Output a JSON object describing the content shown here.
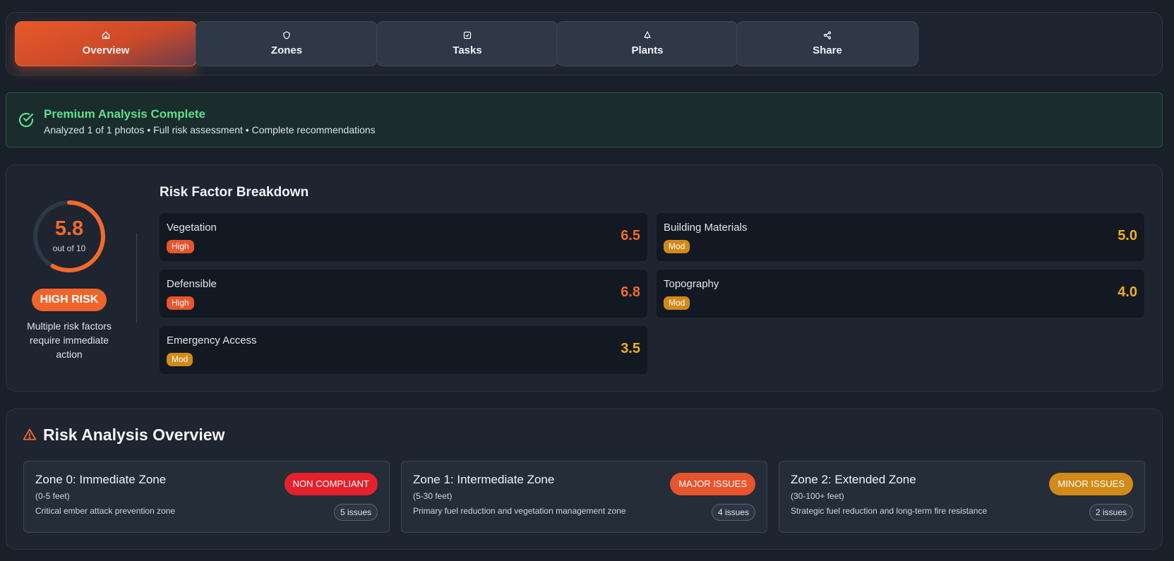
{
  "tabs": [
    {
      "label": "Overview",
      "icon": "home-icon",
      "active": true
    },
    {
      "label": "Zones",
      "icon": "shield-icon",
      "active": false
    },
    {
      "label": "Tasks",
      "icon": "check-square-icon",
      "active": false
    },
    {
      "label": "Plants",
      "icon": "tree-icon",
      "active": false
    },
    {
      "label": "Share",
      "icon": "share-icon",
      "active": false
    }
  ],
  "alert": {
    "title": "Premium Analysis Complete",
    "description": "Analyzed 1 of 1 photos • Full risk assessment • Complete recommendations",
    "icon": "check-circle-icon",
    "color": "#5fe08f"
  },
  "score": {
    "value": "5.8",
    "scale_label": "out of 10",
    "fraction": 0.58,
    "risk_label": "HIGH RISK",
    "description": "Multiple risk factors require immediate action",
    "color": "#f26a2a"
  },
  "breakdown": {
    "title": "Risk Factor Breakdown",
    "factors": [
      {
        "name": "Vegetation",
        "level": "High",
        "score": "6.5"
      },
      {
        "name": "Building Materials",
        "level": "Mod",
        "score": "5.0"
      },
      {
        "name": "Defensible",
        "level": "High",
        "score": "6.8"
      },
      {
        "name": "Topography",
        "level": "Mod",
        "score": "4.0"
      },
      {
        "name": "Emergency Access",
        "level": "Mod",
        "score": "3.5"
      }
    ]
  },
  "level_colors": {
    "High": "#e8542c",
    "Mod": "#d28a18"
  },
  "score_colors": {
    "High": "#f26a2a",
    "Mod": "#f0ad26"
  },
  "analysis": {
    "title": "Risk Analysis Overview",
    "icon": "warning-triangle-icon",
    "zones": [
      {
        "name": "Zone 0: Immediate Zone",
        "range": "(0-5 feet)",
        "description": "Critical ember attack prevention zone",
        "status": "NON COMPLIANT",
        "status_color": "#e4222d",
        "issues": "5 issues"
      },
      {
        "name": "Zone 1: Intermediate Zone",
        "range": "(5-30 feet)",
        "description": "Primary fuel reduction and vegetation management zone",
        "status": "MAJOR ISSUES",
        "status_color": "#e8542c",
        "issues": "4 issues"
      },
      {
        "name": "Zone 2: Extended Zone",
        "range": "(30-100+ feet)",
        "description": "Strategic fuel reduction and long-term fire resistance",
        "status": "MINOR ISSUES",
        "status_color": "#d28a18",
        "issues": "2 issues"
      }
    ]
  }
}
